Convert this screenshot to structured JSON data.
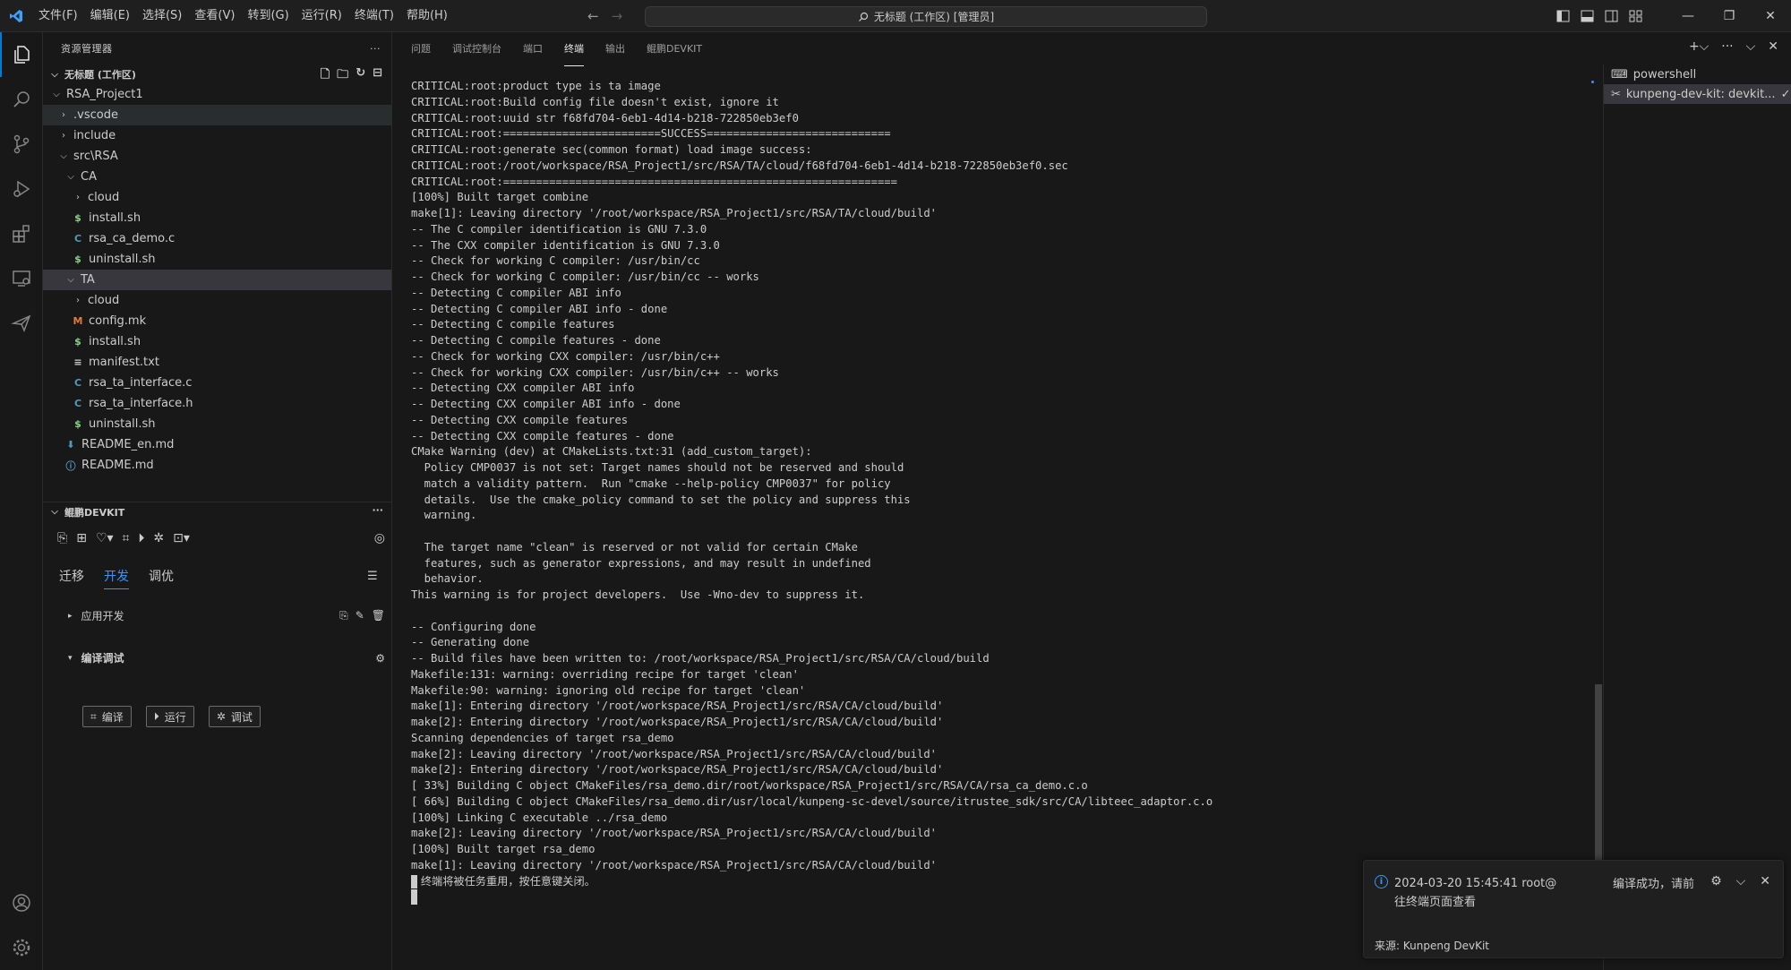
{
  "menu": [
    "文件(F)",
    "编辑(E)",
    "选择(S)",
    "查看(V)",
    "转到(G)",
    "运行(R)",
    "终端(T)",
    "帮助(H)"
  ],
  "command_center": "无标题 (工作区) [管理员]",
  "sidebar": {
    "title": "资源管理器",
    "workspace": "无标题 (工作区)",
    "tree": [
      {
        "label": "RSA_Project1",
        "depth": 0,
        "kind": "folder-open"
      },
      {
        "label": ".vscode",
        "depth": 1,
        "kind": "folder"
      },
      {
        "label": "include",
        "depth": 1,
        "kind": "folder"
      },
      {
        "label": "src\\RSA",
        "depth": 1,
        "kind": "folder-open"
      },
      {
        "label": "CA",
        "depth": 2,
        "kind": "folder-open"
      },
      {
        "label": "cloud",
        "depth": 3,
        "kind": "folder"
      },
      {
        "label": "install.sh",
        "depth": 3,
        "kind": "sh"
      },
      {
        "label": "rsa_ca_demo.c",
        "depth": 3,
        "kind": "c"
      },
      {
        "label": "uninstall.sh",
        "depth": 3,
        "kind": "sh"
      },
      {
        "label": "TA",
        "depth": 2,
        "kind": "folder-open"
      },
      {
        "label": "cloud",
        "depth": 3,
        "kind": "folder"
      },
      {
        "label": "config.mk",
        "depth": 3,
        "kind": "mk"
      },
      {
        "label": "install.sh",
        "depth": 3,
        "kind": "sh"
      },
      {
        "label": "manifest.txt",
        "depth": 3,
        "kind": "txt"
      },
      {
        "label": "rsa_ta_interface.c",
        "depth": 3,
        "kind": "c"
      },
      {
        "label": "rsa_ta_interface.h",
        "depth": 3,
        "kind": "c"
      },
      {
        "label": "uninstall.sh",
        "depth": 3,
        "kind": "sh"
      },
      {
        "label": "README_en.md",
        "depth": 2,
        "kind": "md"
      },
      {
        "label": "README.md",
        "depth": 2,
        "kind": "info"
      }
    ]
  },
  "devkit": {
    "header": "鲲鹏DEVKIT",
    "tabs": [
      "迁移",
      "开发",
      "调优"
    ],
    "section_app": "应用开发",
    "section_build": "编译调试",
    "btn_build": "编译",
    "btn_run": "运行",
    "btn_debug": "调试"
  },
  "panel": {
    "tabs": [
      "问题",
      "调试控制台",
      "端口",
      "终端",
      "输出",
      "鲲鹏DEVKIT"
    ],
    "terminal_lines": [
      "CRITICAL:root:product type is ta image",
      "CRITICAL:root:Build config file doesn't exist, ignore it",
      "CRITICAL:root:uuid str f68fd704-6eb1-4d14-b218-722850eb3ef0",
      "CRITICAL:root:========================SUCCESS============================",
      "CRITICAL:root:generate sec(common format) load image success:",
      "CRITICAL:root:/root/workspace/RSA_Project1/src/RSA/TA/cloud/f68fd704-6eb1-4d14-b218-722850eb3ef0.sec",
      "CRITICAL:root:============================================================",
      "[100%] Built target combine",
      "make[1]: Leaving directory '/root/workspace/RSA_Project1/src/RSA/TA/cloud/build'",
      "-- The C compiler identification is GNU 7.3.0",
      "-- The CXX compiler identification is GNU 7.3.0",
      "-- Check for working C compiler: /usr/bin/cc",
      "-- Check for working C compiler: /usr/bin/cc -- works",
      "-- Detecting C compiler ABI info",
      "-- Detecting C compiler ABI info - done",
      "-- Detecting C compile features",
      "-- Detecting C compile features - done",
      "-- Check for working CXX compiler: /usr/bin/c++",
      "-- Check for working CXX compiler: /usr/bin/c++ -- works",
      "-- Detecting CXX compiler ABI info",
      "-- Detecting CXX compiler ABI info - done",
      "-- Detecting CXX compile features",
      "-- Detecting CXX compile features - done",
      "CMake Warning (dev) at CMakeLists.txt:31 (add_custom_target):",
      "  Policy CMP0037 is not set: Target names should not be reserved and should",
      "  match a validity pattern.  Run \"cmake --help-policy CMP0037\" for policy",
      "  details.  Use the cmake_policy command to set the policy and suppress this",
      "  warning.",
      "",
      "  The target name \"clean\" is reserved or not valid for certain CMake",
      "  features, such as generator expressions, and may result in undefined",
      "  behavior.",
      "This warning is for project developers.  Use -Wno-dev to suppress it.",
      "",
      "-- Configuring done",
      "-- Generating done",
      "-- Build files have been written to: /root/workspace/RSA_Project1/src/RSA/CA/cloud/build",
      "Makefile:131: warning: overriding recipe for target 'clean'",
      "Makefile:90: warning: ignoring old recipe for target 'clean'",
      "make[1]: Entering directory '/root/workspace/RSA_Project1/src/RSA/CA/cloud/build'",
      "make[2]: Entering directory '/root/workspace/RSA_Project1/src/RSA/CA/cloud/build'",
      "Scanning dependencies of target rsa_demo",
      "make[2]: Leaving directory '/root/workspace/RSA_Project1/src/RSA/CA/cloud/build'",
      "make[2]: Entering directory '/root/workspace/RSA_Project1/src/RSA/CA/cloud/build'",
      "[ 33%] Building C object CMakeFiles/rsa_demo.dir/root/workspace/RSA_Project1/src/RSA/CA/rsa_ca_demo.c.o",
      "[ 66%] Building C object CMakeFiles/rsa_demo.dir/usr/local/kunpeng-sc-devel/source/itrustee_sdk/src/CA/libteec_adaptor.c.o",
      "[100%] Linking C executable ../rsa_demo",
      "make[2]: Leaving directory '/root/workspace/RSA_Project1/src/RSA/CA/cloud/build'",
      "[100%] Built target rsa_demo",
      "make[1]: Leaving directory '/root/workspace/RSA_Project1/src/RSA/CA/cloud/build'"
    ],
    "terminal_final": " 终端将被任务重用，按任意键关闭。",
    "terminals": [
      "powershell",
      "kunpeng-dev-kit: devkit..."
    ]
  },
  "notification": {
    "text_a": "2024-03-20 15:45:41 root@",
    "text_b": "编译成功，请前",
    "text_c": "往终端页面查看",
    "source": "来源: Kunpeng DevKit"
  }
}
